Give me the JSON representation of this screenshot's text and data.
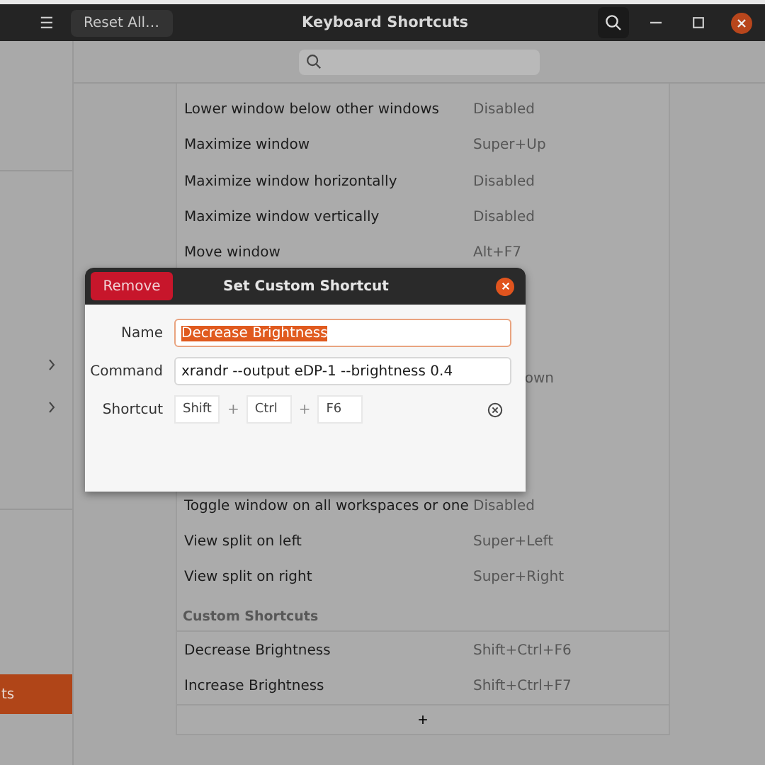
{
  "window": {
    "title": "Keyboard Shortcuts",
    "reset_button": "Reset All…",
    "menu_glyph": "☰"
  },
  "sidebar": {
    "items": [
      {
        "label": "ts",
        "selected": true
      }
    ]
  },
  "shortcuts": [
    {
      "name": "Lower window below other windows",
      "shortcut": "Disabled"
    },
    {
      "name": "Maximize window",
      "shortcut": "Super+Up"
    },
    {
      "name": "Maximize window horizontally",
      "shortcut": "Disabled"
    },
    {
      "name": "Maximize window vertically",
      "shortcut": "Disabled"
    },
    {
      "name": "Move window",
      "shortcut": "Alt+F7"
    }
  ],
  "covered_row": {
    "shortcut": "own"
  },
  "shortcuts_after": [
    {
      "name": "Toggle window on all workspaces or one",
      "shortcut": "Disabled"
    },
    {
      "name": "View split on left",
      "shortcut": "Super+Left"
    },
    {
      "name": "View split on right",
      "shortcut": "Super+Right"
    }
  ],
  "custom_section": {
    "title": "Custom Shortcuts",
    "rows": [
      {
        "name": "Decrease Brightness",
        "shortcut": "Shift+Ctrl+F6"
      },
      {
        "name": "Increase Brightness",
        "shortcut": "Shift+Ctrl+F7"
      }
    ],
    "add": "+"
  },
  "dialog": {
    "title": "Set Custom Shortcut",
    "remove_button": "Remove",
    "name_label": "Name",
    "name_value": "Decrease Brightness",
    "command_label": "Command",
    "command_value": "xrandr --output eDP-1 --brightness 0.4",
    "shortcut_label": "Shortcut",
    "keys": [
      "Shift",
      "Ctrl",
      "F6"
    ],
    "plus": "+"
  }
}
